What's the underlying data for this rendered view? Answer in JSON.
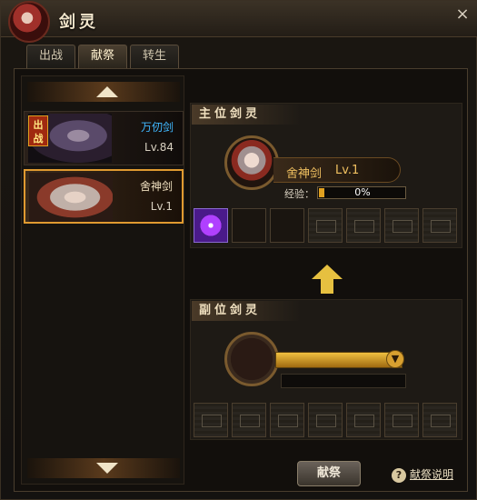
{
  "window": {
    "title": "剑灵",
    "close": "×"
  },
  "tabs": [
    {
      "label": "出战"
    },
    {
      "label": "献祭"
    },
    {
      "label": "转生"
    }
  ],
  "spirit_list": [
    {
      "name": "万仞剑",
      "level": "Lv.84",
      "badge": "出战"
    },
    {
      "name": "舍神剑",
      "level": "Lv.1"
    }
  ],
  "main_spirit": {
    "header": "主位剑灵",
    "name": "舍神剑",
    "level": "Lv.1",
    "exp_label": "经验：",
    "exp_text": "0%"
  },
  "sub_spirit": {
    "header": "副位剑灵"
  },
  "footer": {
    "offer_button": "献祭",
    "help_icon": "?",
    "help_text": "献祭说明"
  },
  "colors": {
    "accent": "#e09a30",
    "name_blue": "#40b8ff",
    "gold": "#f0c060"
  }
}
